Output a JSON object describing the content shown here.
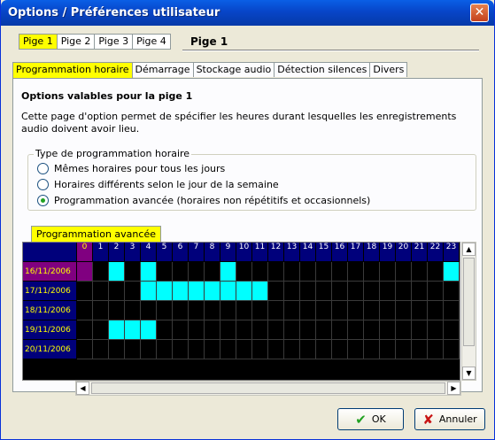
{
  "window": {
    "title": "Options / Préférences utilisateur",
    "close_glyph": "✕"
  },
  "pige_tabs": [
    {
      "label": "Pige 1",
      "active": true
    },
    {
      "label": "Pige 2",
      "active": false
    },
    {
      "label": "Pige 3",
      "active": false
    },
    {
      "label": "Pige 4",
      "active": false
    }
  ],
  "pige_title": "Pige 1",
  "tabs": [
    {
      "label": "Programmation horaire",
      "active": true
    },
    {
      "label": "Démarrage",
      "active": false
    },
    {
      "label": "Stockage audio",
      "active": false
    },
    {
      "label": "Détection silences",
      "active": false
    },
    {
      "label": "Divers",
      "active": false
    }
  ],
  "panel": {
    "heading": "Options valables pour la pige 1",
    "description": "Cette page d'option permet de spécifier les heures durant lesquelles les enregistrements audio doivent avoir lieu.",
    "group_label": "Type de programmation horaire",
    "radios": [
      {
        "label": "Mêmes horaires pour tous les jours",
        "checked": false
      },
      {
        "label": "Horaires différents selon le jour de la semaine",
        "checked": false
      },
      {
        "label": "Programmation avancée (horaires non répétitifs et occasionnels)",
        "checked": true
      }
    ],
    "advanced_tab_label": "Programmation avancée"
  },
  "schedule": {
    "hours": [
      "0",
      "1",
      "2",
      "3",
      "4",
      "5",
      "6",
      "7",
      "8",
      "9",
      "10",
      "11",
      "12",
      "13",
      "14",
      "15",
      "16",
      "17",
      "18",
      "19",
      "20",
      "21",
      "22",
      "23"
    ],
    "selected_hour": 0,
    "rows": [
      {
        "date": "16/11/2006",
        "selected": true,
        "active_hours": [
          2,
          4,
          9,
          23
        ]
      },
      {
        "date": "17/11/2006",
        "selected": false,
        "active_hours": [
          4,
          5,
          6,
          7,
          8,
          9,
          10,
          11
        ]
      },
      {
        "date": "18/11/2006",
        "selected": false,
        "active_hours": []
      },
      {
        "date": "19/11/2006",
        "selected": false,
        "active_hours": [
          2,
          3,
          4
        ]
      },
      {
        "date": "20/11/2006",
        "selected": false,
        "active_hours": []
      }
    ]
  },
  "buttons": {
    "ok": {
      "label": "OK",
      "icon": "check-icon"
    },
    "cancel": {
      "label": "Annuler",
      "icon": "x-icon"
    }
  },
  "colors": {
    "active_tab": "#ffff00",
    "grid_header": "#00007b",
    "grid_selected": "#800080",
    "grid_active": "#00ffff"
  }
}
